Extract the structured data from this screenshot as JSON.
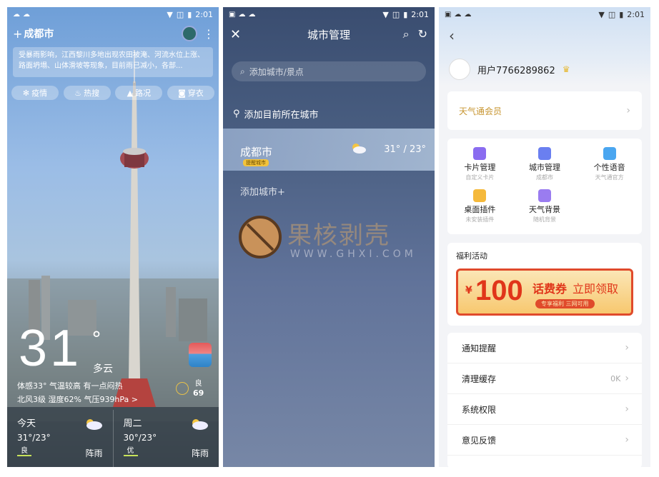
{
  "status": {
    "time": "2:01"
  },
  "panel1": {
    "city": "成都市",
    "alert": "受暴雨影响，江西黎川多地出现农田被淹、河流水位上涨、路面坍塌、山体滑坡等现象，目前雨已减小，各部...",
    "chips": [
      "疫情",
      "热搜",
      "路况",
      "穿衣"
    ],
    "temperature": "31",
    "degree": "°",
    "condition": "多云",
    "feels": "体感33° 气温较高 有一点闷热",
    "wind": "北风3级  湿度62%  气压939hPa >",
    "aqi_label": "良",
    "aqi_value": "69",
    "days": [
      {
        "name": "今天",
        "temp": "31°/23°",
        "aqi": "良",
        "cond": "阵雨"
      },
      {
        "name": "周二",
        "temp": "30°/23°",
        "aqi": "优",
        "cond": "阵雨"
      }
    ]
  },
  "panel2": {
    "title": "城市管理",
    "search_placeholder": "添加城市/景点",
    "locate": "添加目前所在城市",
    "city": {
      "name": "成都市",
      "tag": "提醒城市",
      "temp": "31° / 23°"
    },
    "add_city": "添加城市+",
    "watermark_title": "果核剥壳",
    "watermark_sub": "WWW.GHXI.COM"
  },
  "panel3": {
    "username": "用户7766289862",
    "vip": "天气通会员",
    "grid": [
      {
        "label": "卡片管理",
        "sub": "自定义卡片",
        "color": "#8a6cf0"
      },
      {
        "label": "城市管理",
        "sub": "成都市",
        "color": "#6a7ff0"
      },
      {
        "label": "个性语音",
        "sub": "天气通官方",
        "color": "#4aa6f0"
      },
      {
        "label": "桌面插件",
        "sub": "未安装插件",
        "color": "#f5b93b"
      },
      {
        "label": "天气背景",
        "sub": "随机背景",
        "color": "#9a7cf0"
      }
    ],
    "promo_header": "福利活动",
    "promo": {
      "currency": "¥",
      "amount": "100",
      "coupon": "话费券",
      "claim": "立即领取",
      "pill": "专享福利  三网可用"
    },
    "settings": [
      {
        "label": "通知提醒",
        "value": ""
      },
      {
        "label": "清理缓存",
        "value": "0K"
      },
      {
        "label": "系统权限",
        "value": ""
      },
      {
        "label": "意见反馈",
        "value": ""
      }
    ]
  }
}
